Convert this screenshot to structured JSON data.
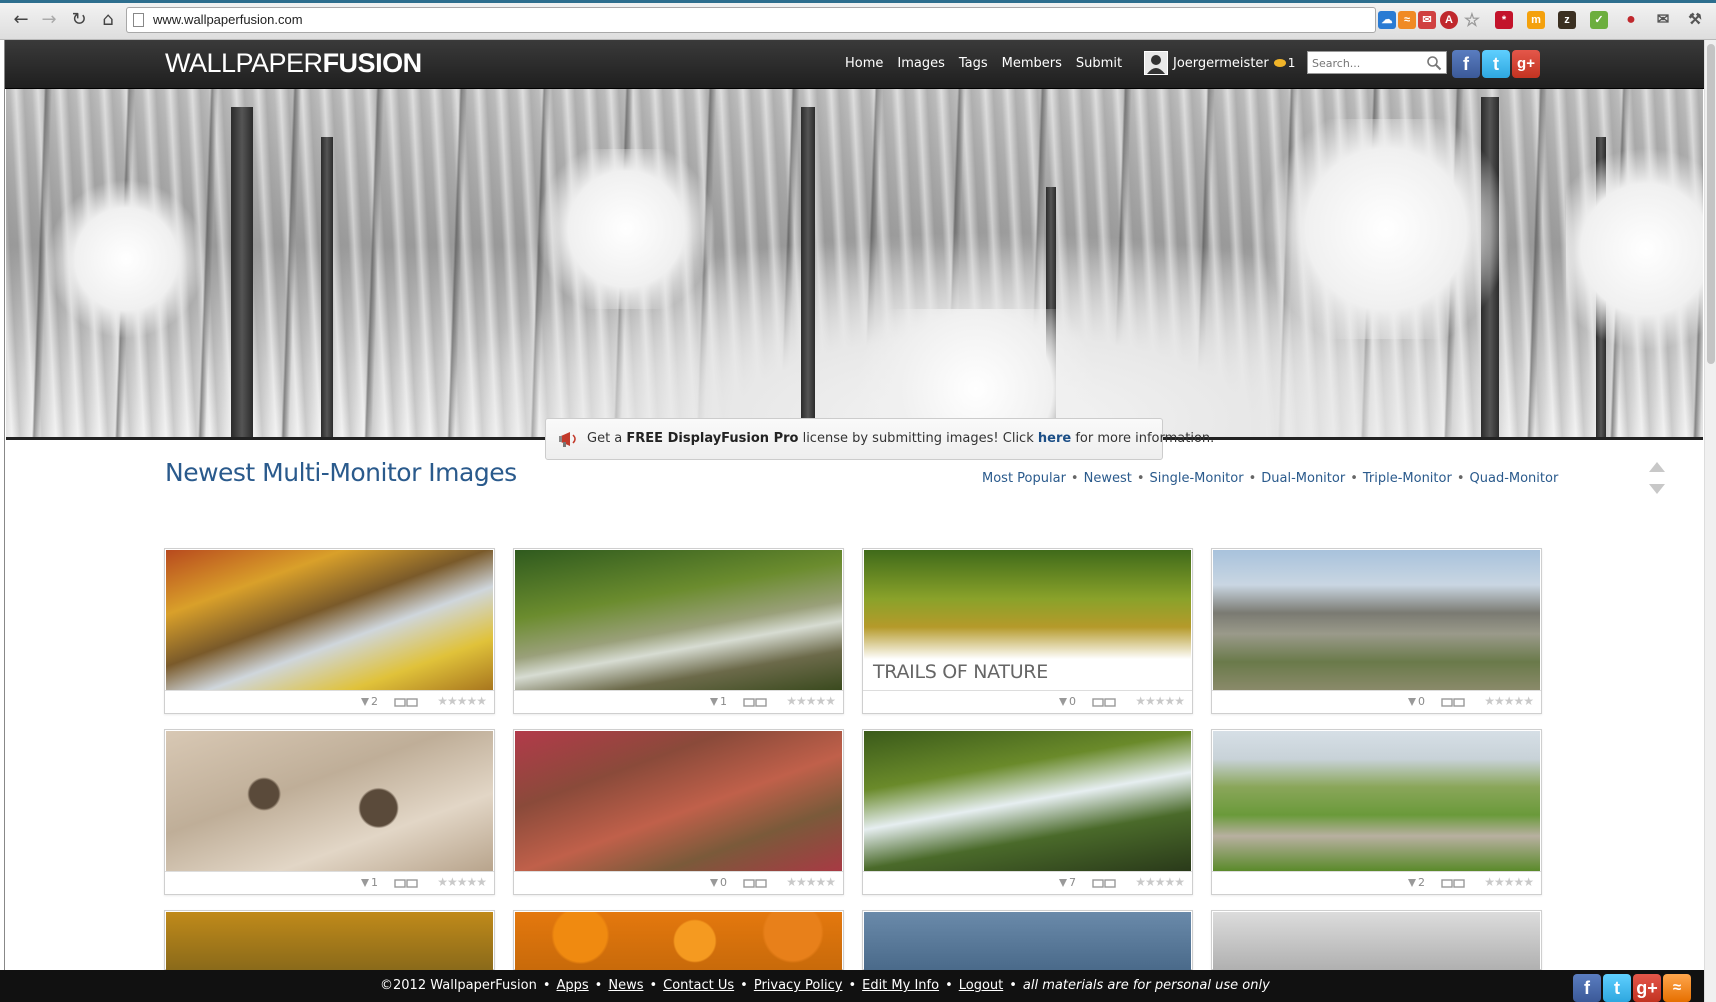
{
  "browser": {
    "url": "www.wallpaperfusion.com"
  },
  "header": {
    "logo_light": "WALLPAPER",
    "logo_bold": "FUSION",
    "nav": [
      "Home",
      "Images",
      "Tags",
      "Members",
      "Submit"
    ],
    "username": "Joergermeister",
    "coin_count": "1",
    "search_placeholder": "Search..."
  },
  "promo": {
    "pre": "Get a ",
    "bold": "FREE DisplayFusion Pro",
    "mid": " license by submitting images! Click ",
    "link": "here",
    "post": " for more information."
  },
  "section": {
    "title": "Newest Multi-Monitor Images",
    "filters": [
      "Most Popular",
      "Newest",
      "Single-Monitor",
      "Dual-Monitor",
      "Triple-Monitor",
      "Quad-Monitor"
    ]
  },
  "cards": [
    {
      "downloads": "2"
    },
    {
      "downloads": "1"
    },
    {
      "downloads": "0",
      "overlay": "TRAILS OF NATURE"
    },
    {
      "downloads": "0"
    },
    {
      "downloads": "1"
    },
    {
      "downloads": "0"
    },
    {
      "downloads": "7"
    },
    {
      "downloads": "2"
    }
  ],
  "footer": {
    "copyright": "©2012 WallpaperFusion",
    "links": [
      "Apps",
      "News",
      "Contact Us",
      "Privacy Policy",
      "Edit My Info",
      "Logout"
    ],
    "note": "all materials are for personal use only"
  },
  "colors": {
    "link": "#2a5a8c",
    "header_bg": "#2a2a2a",
    "footer_bg": "#111111"
  }
}
